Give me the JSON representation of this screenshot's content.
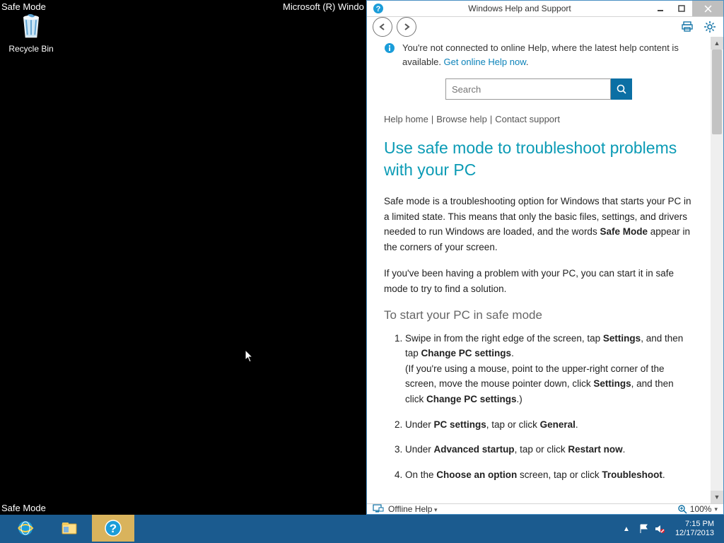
{
  "desktop": {
    "corner_tl": "Safe Mode",
    "corner_tc": "Microsoft (R) Windo",
    "corner_bl": "Safe Mode",
    "recycle_bin_label": "Recycle Bin"
  },
  "taskbar": {
    "time": "7:15 PM",
    "date": "12/17/2013"
  },
  "help": {
    "window_title": "Windows Help and Support",
    "notice_text": "You're not connected to online Help, where the latest help content is available. ",
    "notice_link": "Get online Help now",
    "notice_period": ".",
    "search_placeholder": "Search",
    "crumbs": {
      "home": "Help home",
      "browse": "Browse help",
      "contact": "Contact support"
    },
    "title": "Use safe mode to troubleshoot problems with your PC",
    "para1a": "Safe mode is a troubleshooting option for Windows that starts your PC in a limited state. This means that only the basic files, settings, and drivers needed to run Windows are loaded, and the words ",
    "para1b": "Safe Mode",
    "para1c": " appear in the corners of your screen.",
    "para2": "If you've been having a problem with your PC, you can start it in safe mode to try to find a solution.",
    "subhead": "To start your PC in safe mode",
    "steps": {
      "s1a": "Swipe in from the right edge of the screen, tap ",
      "s1b": "Settings",
      "s1c": ", and then tap ",
      "s1d": "Change PC settings",
      "s1e": ".",
      "s1f": "(If you're using a mouse, point to the upper-right corner of the screen, move the mouse pointer down, click ",
      "s1g": "Settings",
      "s1h": ", and then click ",
      "s1i": "Change PC settings",
      "s1j": ".)",
      "s2a": "Under ",
      "s2b": "PC settings",
      "s2c": ", tap or click ",
      "s2d": "General",
      "s2e": ".",
      "s3a": "Under ",
      "s3b": "Advanced startup",
      "s3c": ", tap or click ",
      "s3d": "Restart now",
      "s3e": ".",
      "s4a": "On the ",
      "s4b": "Choose an option",
      "s4c": " screen, tap or click ",
      "s4d": "Troubleshoot",
      "s4e": "."
    },
    "status_offline": "Offline Help",
    "status_zoom": "100%"
  }
}
